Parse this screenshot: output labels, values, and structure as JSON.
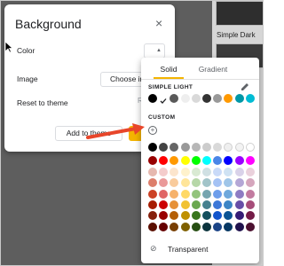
{
  "dialog": {
    "title": "Background",
    "close_icon": "×",
    "rows": {
      "color_label": "Color",
      "image_label": "Image",
      "reset_label": "Reset to theme"
    },
    "choose_image_label": "Choose ima",
    "reset_button_label": "Re",
    "add_to_theme_label": "Add to theme"
  },
  "background_app": {
    "theme_caption": "Simple Dark"
  },
  "picker": {
    "tabs": [
      "Solid",
      "Gradient"
    ],
    "active_tab": "Solid",
    "simple_light_label": "SIMPLE LIGHT",
    "custom_label": "CUSTOM",
    "transparent_label": "Transparent",
    "theme_colors": [
      "#000000",
      "#ffffff",
      "#595959",
      "#eeeeee",
      "#d9d9d9",
      "#333333",
      "#999999",
      "#ff9900",
      "#0097a7",
      "#00bcd4"
    ],
    "palette_rows": [
      [
        "#000000",
        "#434343",
        "#666666",
        "#999999",
        "#b7b7b7",
        "#cccccc",
        "#d9d9d9",
        "#efefef",
        "#f3f3f3",
        "#ffffff"
      ],
      [
        "#980000",
        "#ff0000",
        "#ff9900",
        "#ffff00",
        "#00ff00",
        "#00ffff",
        "#4a86e8",
        "#0000ff",
        "#9900ff",
        "#ff00ff"
      ],
      [
        "#e6b8af",
        "#f4cccc",
        "#fce5cd",
        "#fff2cc",
        "#d9ead3",
        "#d0e0e3",
        "#c9daf8",
        "#cfe2f3",
        "#d9d2e9",
        "#ead1dc"
      ],
      [
        "#dd7e6b",
        "#ea9999",
        "#f9cb9c",
        "#ffe599",
        "#b6d7a8",
        "#a2c4c9",
        "#a4c2f4",
        "#9fc5e8",
        "#b4a7d6",
        "#d5a6bd"
      ],
      [
        "#cc4125",
        "#e06666",
        "#f6b26b",
        "#ffd966",
        "#93c47d",
        "#76a5af",
        "#6d9eeb",
        "#6fa8dc",
        "#8e7cc3",
        "#c27ba0"
      ],
      [
        "#a61c00",
        "#cc0000",
        "#e69138",
        "#f1c232",
        "#6aa84f",
        "#45818e",
        "#3c78d8",
        "#3d85c6",
        "#674ea7",
        "#a64d79"
      ],
      [
        "#85200c",
        "#990000",
        "#b45f06",
        "#bf9000",
        "#38761d",
        "#134f5c",
        "#1155cc",
        "#0b5394",
        "#351c75",
        "#741b47"
      ],
      [
        "#5b0f00",
        "#660000",
        "#783f04",
        "#7f6000",
        "#274e13",
        "#0c343d",
        "#1c4587",
        "#073763",
        "#20124d",
        "#4c1130"
      ]
    ]
  },
  "colors": {
    "accent_yellow": "#f4b400",
    "arrow_red": "#e8462a"
  }
}
